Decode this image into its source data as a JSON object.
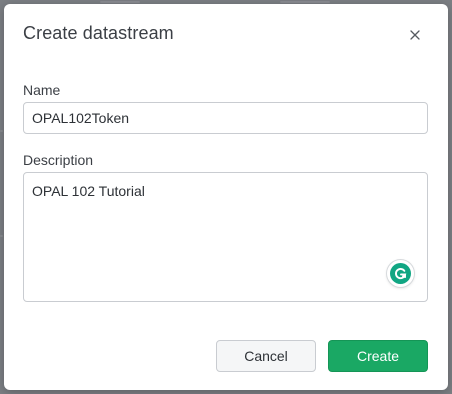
{
  "dialog": {
    "title": "Create datastream",
    "close_icon": "close-icon"
  },
  "form": {
    "name_label": "Name",
    "name_value": "OPAL102Token",
    "description_label": "Description",
    "description_value": "OPAL 102 Tutorial"
  },
  "actions": {
    "cancel_label": "Cancel",
    "create_label": "Create"
  },
  "colors": {
    "primary": "#1aa864",
    "grammarly": "#11a683"
  }
}
